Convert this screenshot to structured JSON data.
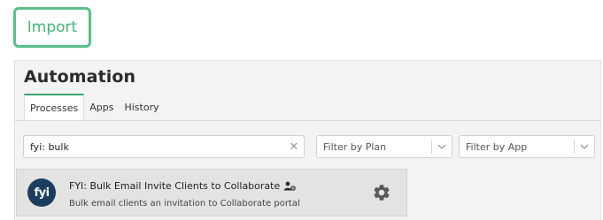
{
  "import_button": {
    "label": "Import"
  },
  "automation": {
    "title": "Automation",
    "tabs": [
      {
        "label": "Processes",
        "active": true
      },
      {
        "label": "Apps",
        "active": false
      },
      {
        "label": "History",
        "active": false
      }
    ],
    "search": {
      "value": "fyi: bulk",
      "clear_icon": "close-icon"
    },
    "filters": {
      "plan": {
        "placeholder": "Filter by Plan"
      },
      "app": {
        "placeholder": "Filter by App"
      }
    },
    "processes": [
      {
        "logo_text": "fyi",
        "title": "FYI: Bulk Email Invite Clients to Collaborate",
        "description": "Bulk email clients an invitation to Collaborate portal",
        "icons": [
          "user-settings-icon",
          "gear-icon"
        ]
      }
    ]
  },
  "colors": {
    "accent_green": "#3aa675",
    "import_border": "#5cc08a",
    "logo_bg": "#1c3d5e",
    "card_bg": "#e3e3e3",
    "panel_bg": "#f3f3f3"
  }
}
